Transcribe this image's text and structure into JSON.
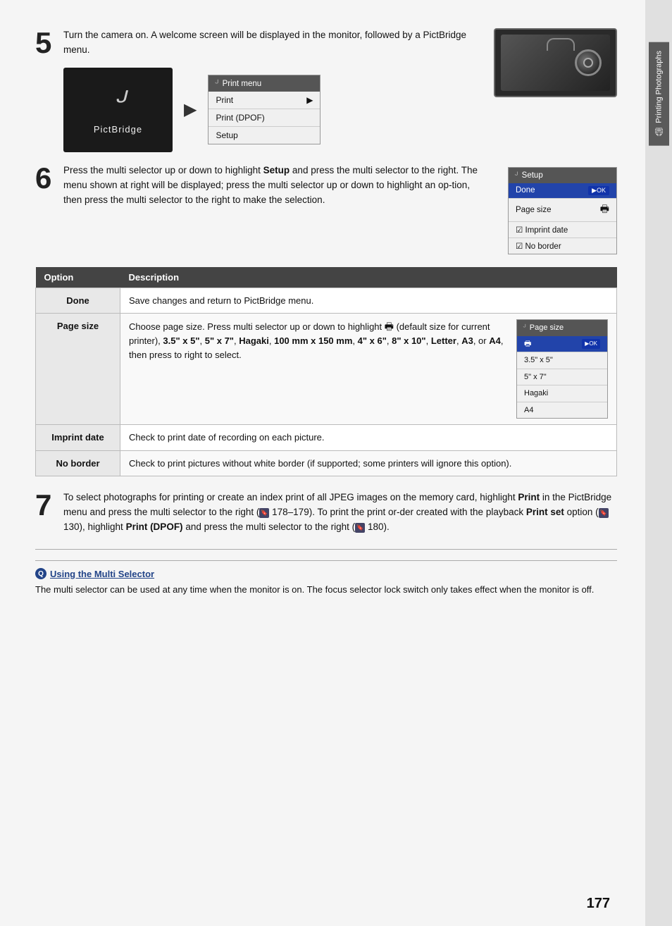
{
  "page": {
    "number": "177",
    "sidebar_label": "Printing Photographs",
    "sidebar_icon": "🖨"
  },
  "step5": {
    "number": "5",
    "text": "Turn the camera on.  A welcome screen will be  displayed  in  the  monitor,  followed  by  a PictBridge menu.",
    "pictbridge_logo": "ᒢ",
    "pictbridge_label": "PictBridge",
    "arrow": "▶",
    "print_menu_title": "Print menu",
    "menu_items": [
      {
        "label": "Print",
        "arrow": "▶"
      },
      {
        "label": "Print (DPOF)",
        "arrow": ""
      },
      {
        "label": "Setup",
        "arrow": ""
      }
    ]
  },
  "step6": {
    "number": "6",
    "text_before": "Press the multi selector up or down to highlight",
    "bold_word": "Setup",
    "text_after": " and press the multi selector to the right. The menu shown at right will be displayed; press the multi selector up or down to highlight an op-tion, then press the multi selector to the right to make the selection.",
    "setup_title": "Setup",
    "setup_items": [
      {
        "label": "Done",
        "right": "▶OK",
        "highlighted": true
      },
      {
        "label": "Page size",
        "right": "🖶",
        "highlighted": false
      },
      {
        "label": "☑ Imprint date",
        "right": "",
        "highlighted": false
      },
      {
        "label": "☑ No border",
        "right": "",
        "highlighted": false
      }
    ]
  },
  "table": {
    "headers": [
      "Option",
      "Description"
    ],
    "rows": [
      {
        "option": "Done",
        "description": "Save changes and return to PictBridge menu.",
        "has_submenu": false
      },
      {
        "option": "Page size",
        "description_text": "Choose  page  size.   Press  multi  selector up  or  down  to  highlight",
        "description_bold": " 🖶",
        "description_after": " (default size for  current  printer),  3.5\" x 5\",  5\" x 7\", Hagaki,  100 mm x 150 mm,  4\" x 6\", 8\" x 10\", Letter, A3, or A4, then press to right to select.",
        "has_submenu": true,
        "submenu_title": "Page size",
        "submenu_items": [
          {
            "label": "🖶",
            "right": "▶OK",
            "highlighted": true
          },
          {
            "label": "3.5\"  x 5\"",
            "right": "",
            "highlighted": false
          },
          {
            "label": "5\"  x 7\"",
            "right": "",
            "highlighted": false
          },
          {
            "label": "Hagaki",
            "right": "",
            "highlighted": false
          },
          {
            "label": "A4",
            "right": "",
            "highlighted": false
          }
        ]
      },
      {
        "option": "Imprint date",
        "description": "Check to print date of recording on each picture.",
        "has_submenu": false
      },
      {
        "option": "No border",
        "description": "Check to print pictures without white border (if supported; some printers will ignore this option).",
        "has_submenu": false
      }
    ]
  },
  "step7": {
    "number": "7",
    "text1": "To select photographs for printing or create an index print of all JPEG images on the memory card, highlight ",
    "bold1": "Print",
    "text2": " in the PictBridge menu and press the multi selector to the right (",
    "ref1": "🔖 178–179",
    "text3": ").  To print the print or-der created with the playback ",
    "bold2": "Print set",
    "text4": " option (",
    "ref2": "🔖 130",
    "text5": "), highlight ",
    "bold3": "Print (DPOF)",
    "text6": " and press the multi selector to the right (",
    "ref3": "🔖 180",
    "text7": ")."
  },
  "note": {
    "icon": "Q",
    "title": "Using the Multi Selector",
    "text": "The multi selector can be used at any time when the monitor is on.  The focus selector lock switch only takes effect when the monitor is off."
  }
}
